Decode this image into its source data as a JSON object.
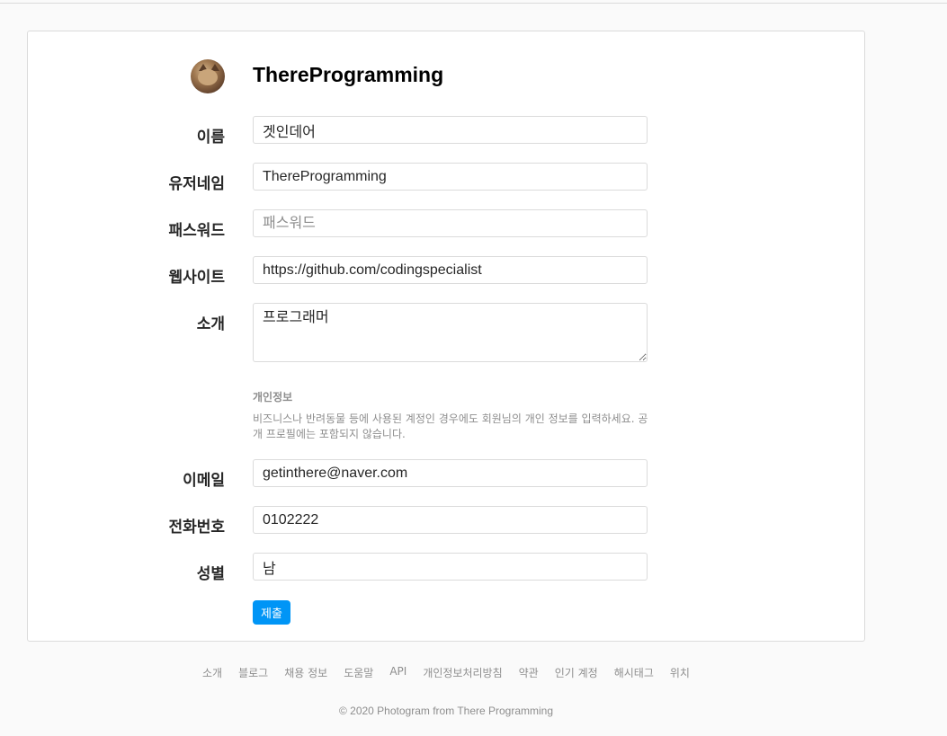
{
  "profile": {
    "username": "ThereProgramming"
  },
  "form": {
    "name": {
      "label": "이름",
      "value": "겟인데어"
    },
    "user_name": {
      "label": "유저네임",
      "value": "ThereProgramming"
    },
    "password": {
      "label": "패스워드",
      "value": "",
      "placeholder": "패스워드"
    },
    "website": {
      "label": "웹사이트",
      "value": "https://github.com/codingspecialist"
    },
    "bio": {
      "label": "소개",
      "value": "프로그래머"
    },
    "private_info": {
      "title": "개인정보",
      "description": "비즈니스나 반려동물 등에 사용된 계정인 경우에도 회원님의 개인 정보를 입력하세요. 공개 프로필에는 포함되지 않습니다."
    },
    "email": {
      "label": "이메일",
      "value": "getinthere@naver.com"
    },
    "phone": {
      "label": "전화번호",
      "value": "0102222"
    },
    "gender": {
      "label": "성별",
      "value": "남"
    },
    "submit_label": "제출"
  },
  "footer": {
    "links": [
      "소개",
      "블로그",
      "채용 정보",
      "도움말",
      "API",
      "개인정보처리방침",
      "약관",
      "인기 계정",
      "해시태그",
      "위치"
    ],
    "copyright": "© 2020 Photogram from There Programming"
  },
  "colors": {
    "background": "#fafafa",
    "card": "#ffffff",
    "border": "#dbdbdb",
    "accent": "#0095f6",
    "muted_text": "#8e8e8e"
  }
}
